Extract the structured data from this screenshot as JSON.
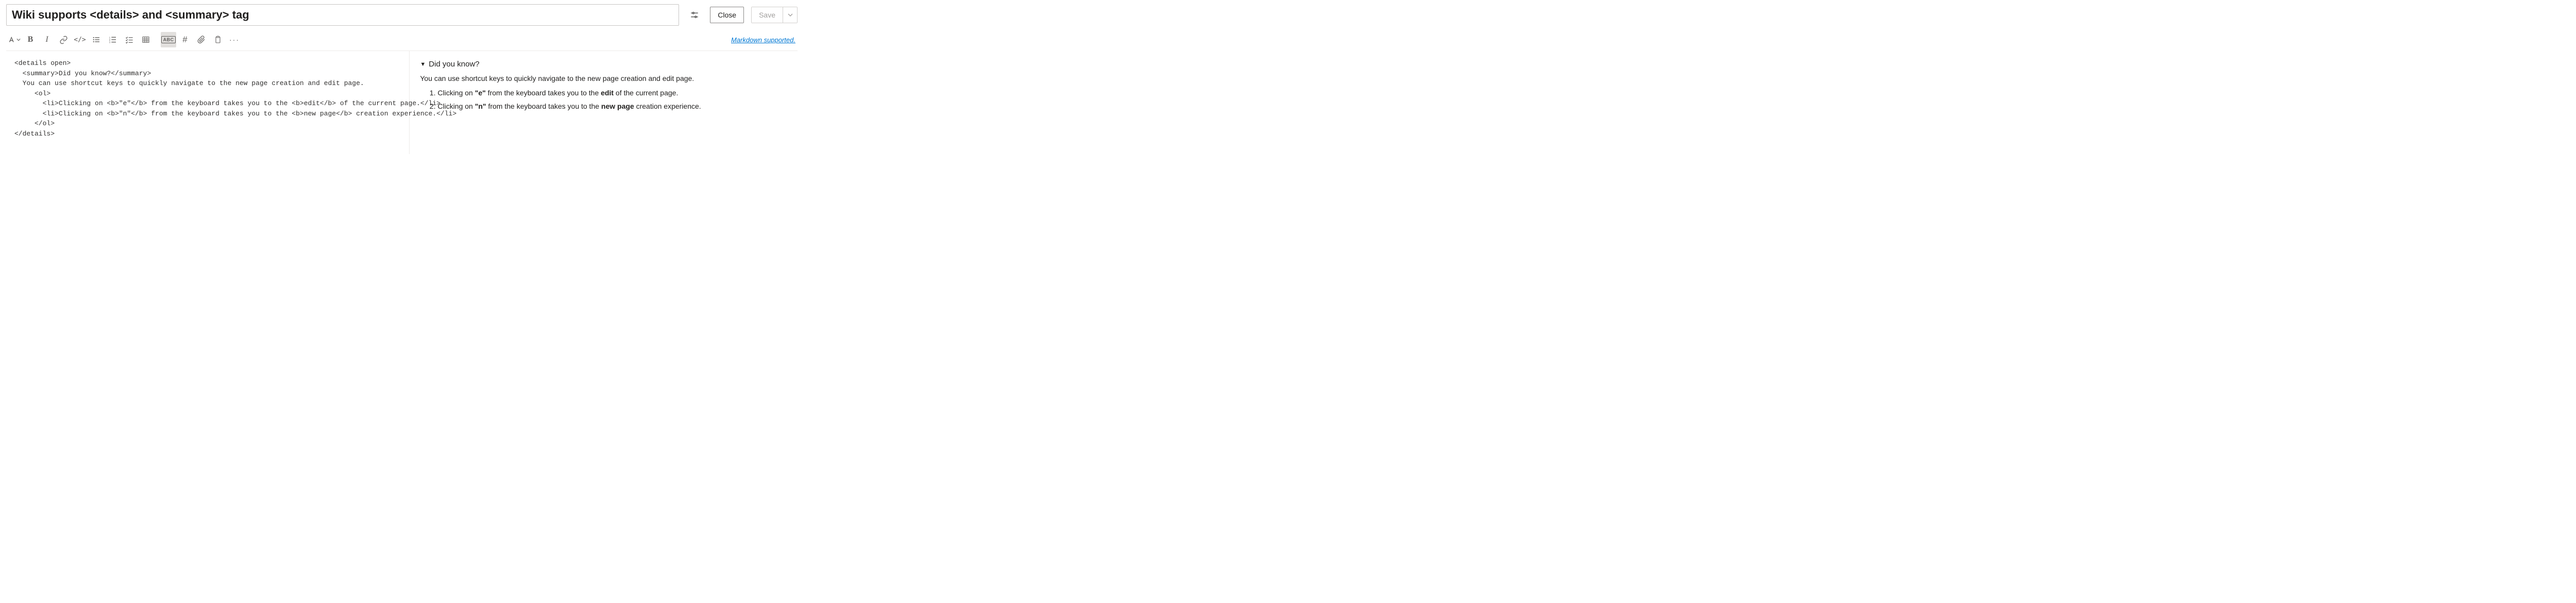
{
  "header": {
    "title_value": "Wiki supports <details> and <summary> tag",
    "close_label": "Close",
    "save_label": "Save"
  },
  "toolbar": {
    "markdown_link": "Markdown supported.",
    "hash_glyph": "#",
    "bold_glyph": "B",
    "italic_glyph": "I",
    "code_glyph": "</>",
    "spell_glyph": "ABC",
    "more_glyph": "···"
  },
  "editor": {
    "lines": [
      "<details open>",
      "  <summary>Did you know?</summary>",
      "  You can use shortcut keys to quickly navigate to the new page creation and edit page.",
      "     <ol>",
      "       <li>Clicking on <b>\"e\"</b> from the keyboard takes you to the <b>edit</b> of the current page.</li>",
      "       <li>Clicking on <b>\"n\"</b> from the keyboard takes you to the <b>new page</b> creation experience.</li>",
      "     </ol>",
      "</details>"
    ]
  },
  "preview": {
    "summary": "Did you know?",
    "intro": "You can use shortcut keys to quickly navigate to the new page creation and edit page.",
    "item1_pre": "Clicking on ",
    "item1_key": "\"e\"",
    "item1_mid": " from the keyboard takes you to the ",
    "item1_bold": "edit",
    "item1_post": " of the current page.",
    "item2_pre": "Clicking on ",
    "item2_key": "\"n\"",
    "item2_mid": " from the keyboard takes you to the ",
    "item2_bold": "new page",
    "item2_post": " creation experience."
  }
}
